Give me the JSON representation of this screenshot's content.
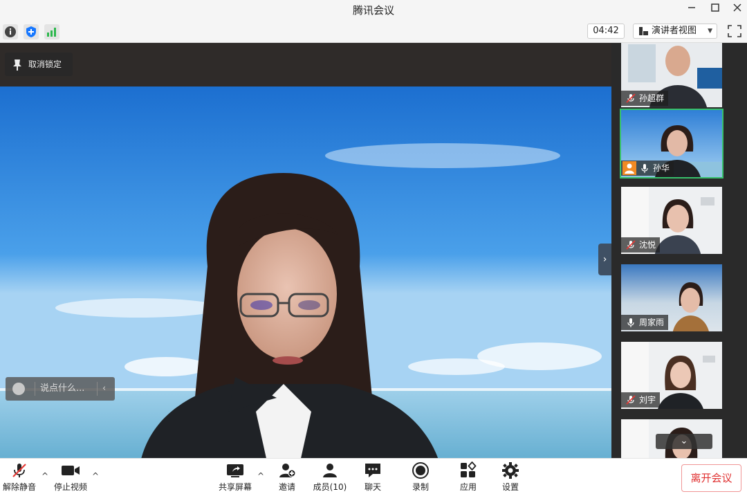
{
  "window": {
    "title": "腾讯会议"
  },
  "toolbar": {
    "timer": "04:42",
    "view_label": "演讲者视图",
    "icons": [
      "info-icon",
      "shield-icon",
      "signal-icon",
      "fullscreen-icon"
    ]
  },
  "main": {
    "pin_label": "取消锁定",
    "chat_placeholder": "说点什么..."
  },
  "participants": [
    {
      "name": "孙超群",
      "mic": "muted"
    },
    {
      "name": "孙华",
      "mic": "on",
      "host": true,
      "speaking": true
    },
    {
      "name": "沈悦",
      "mic": "muted"
    },
    {
      "name": "周家雨",
      "mic": "on"
    },
    {
      "name": "刘宇",
      "mic": "muted"
    },
    {
      "name": "",
      "mic": ""
    }
  ],
  "bottom": {
    "unmute": "解除静音",
    "stop_video": "停止视频",
    "share": "共享屏幕",
    "invite": "邀请",
    "members": "成员(10)",
    "chat": "聊天",
    "record": "录制",
    "apps": "应用",
    "settings": "设置",
    "leave": "离开会议"
  },
  "colors": {
    "leave": "#e03030",
    "active_border": "#37c16b",
    "host_badge": "#f08a24"
  }
}
